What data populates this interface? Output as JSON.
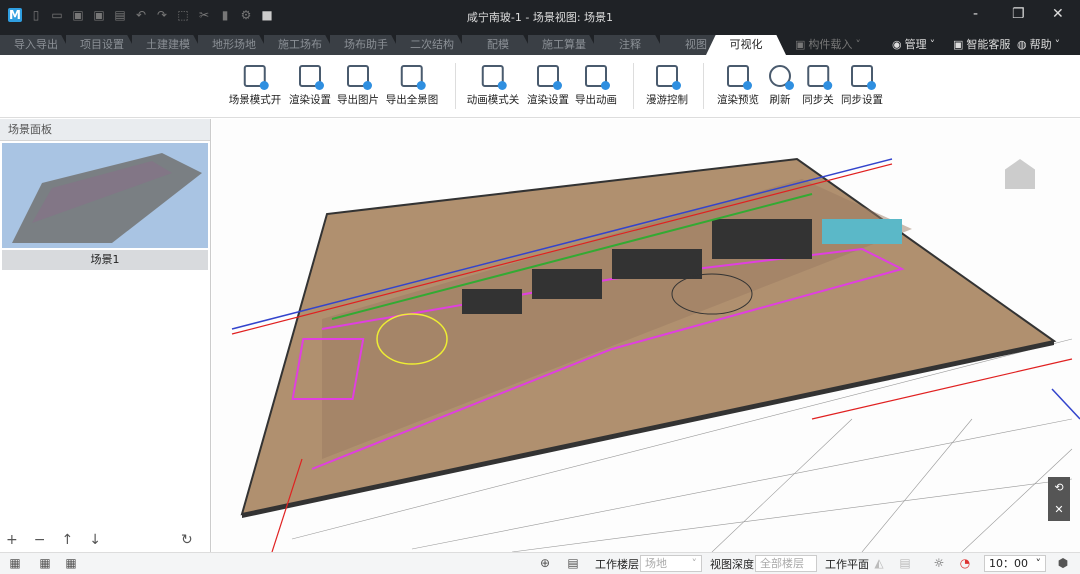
{
  "window": {
    "title": "咸宁南玻-1 - 场景视图: 场景1",
    "minimize": "-",
    "restore": "❐",
    "close": "✕"
  },
  "tabs": [
    "导入导出",
    "项目设置",
    "土建建模",
    "地形场地",
    "施工场布",
    "场布助手",
    "二次结构",
    "配模",
    "施工算量",
    "注释",
    "视图",
    "可视化"
  ],
  "active_tab": "可视化",
  "right_menu": {
    "component_load": "构件载入",
    "manage": "管理",
    "service": "智能客服",
    "help": "帮助"
  },
  "ribbon": [
    {
      "label": "场景模式开"
    },
    {
      "label": "渲染设置"
    },
    {
      "label": "导出图片"
    },
    {
      "label": "导出全景图"
    },
    {
      "label": "动画模式关"
    },
    {
      "label": "渲染设置"
    },
    {
      "label": "导出动画"
    },
    {
      "label": "漫游控制"
    },
    {
      "label": "渲染预览"
    },
    {
      "label": "刷新"
    },
    {
      "label": "同步关"
    },
    {
      "label": "同步设置"
    }
  ],
  "panel": {
    "title": "场景面板",
    "scene_label": "场景1",
    "tools": [
      "+",
      "−",
      "↑",
      "↓",
      "↻"
    ]
  },
  "status": {
    "work_floor_label": "工作楼层",
    "work_floor_value": "场地",
    "view_depth_label": "视图深度",
    "view_depth_value": "全部楼层",
    "work_plane_label": "工作平面",
    "time_value": "10：00"
  }
}
